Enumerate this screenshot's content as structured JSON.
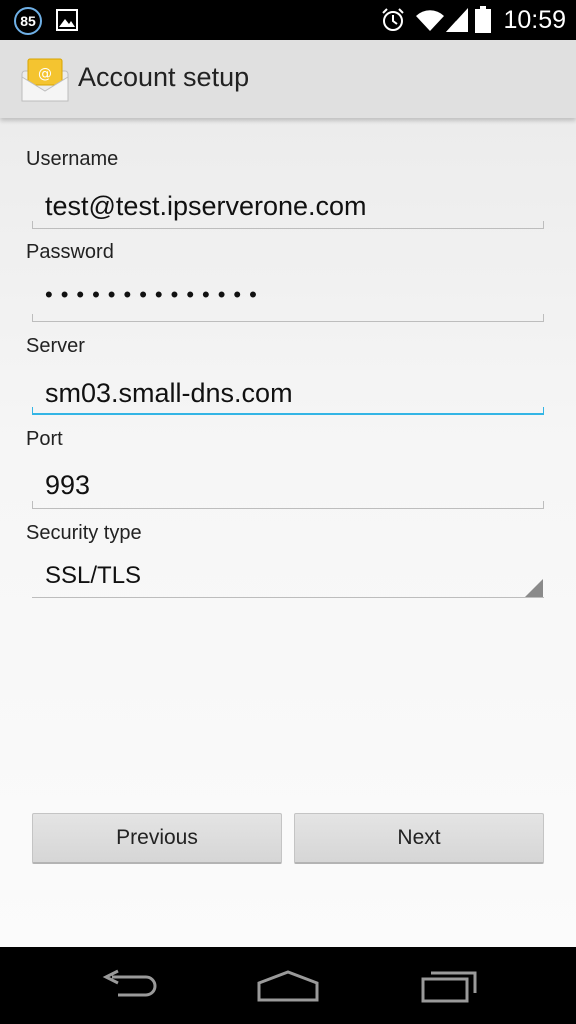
{
  "status_bar": {
    "notification_count": "85",
    "time": "10:59",
    "icons": [
      "notification-count-icon",
      "gallery-icon",
      "alarm-icon",
      "wifi-icon",
      "signal-icon",
      "battery-icon"
    ]
  },
  "action_bar": {
    "title": "Account setup",
    "icon": "email-app-icon"
  },
  "form": {
    "username_label": "Username",
    "username_value": "test@test.ipserverone.com",
    "password_label": "Password",
    "password_mask": "••••••••••••••",
    "server_label": "Server",
    "server_value": "sm03.small-dns.com",
    "port_label": "Port",
    "port_value": "993",
    "security_label": "Security type",
    "security_value": "SSL/TLS"
  },
  "buttons": {
    "previous": "Previous",
    "next": "Next"
  },
  "colors": {
    "focus_accent": "#33b5e5",
    "action_bar_bg": "#e0e0e0"
  },
  "nav_bar": {
    "icons": [
      "back-icon",
      "home-icon",
      "recents-icon"
    ]
  }
}
